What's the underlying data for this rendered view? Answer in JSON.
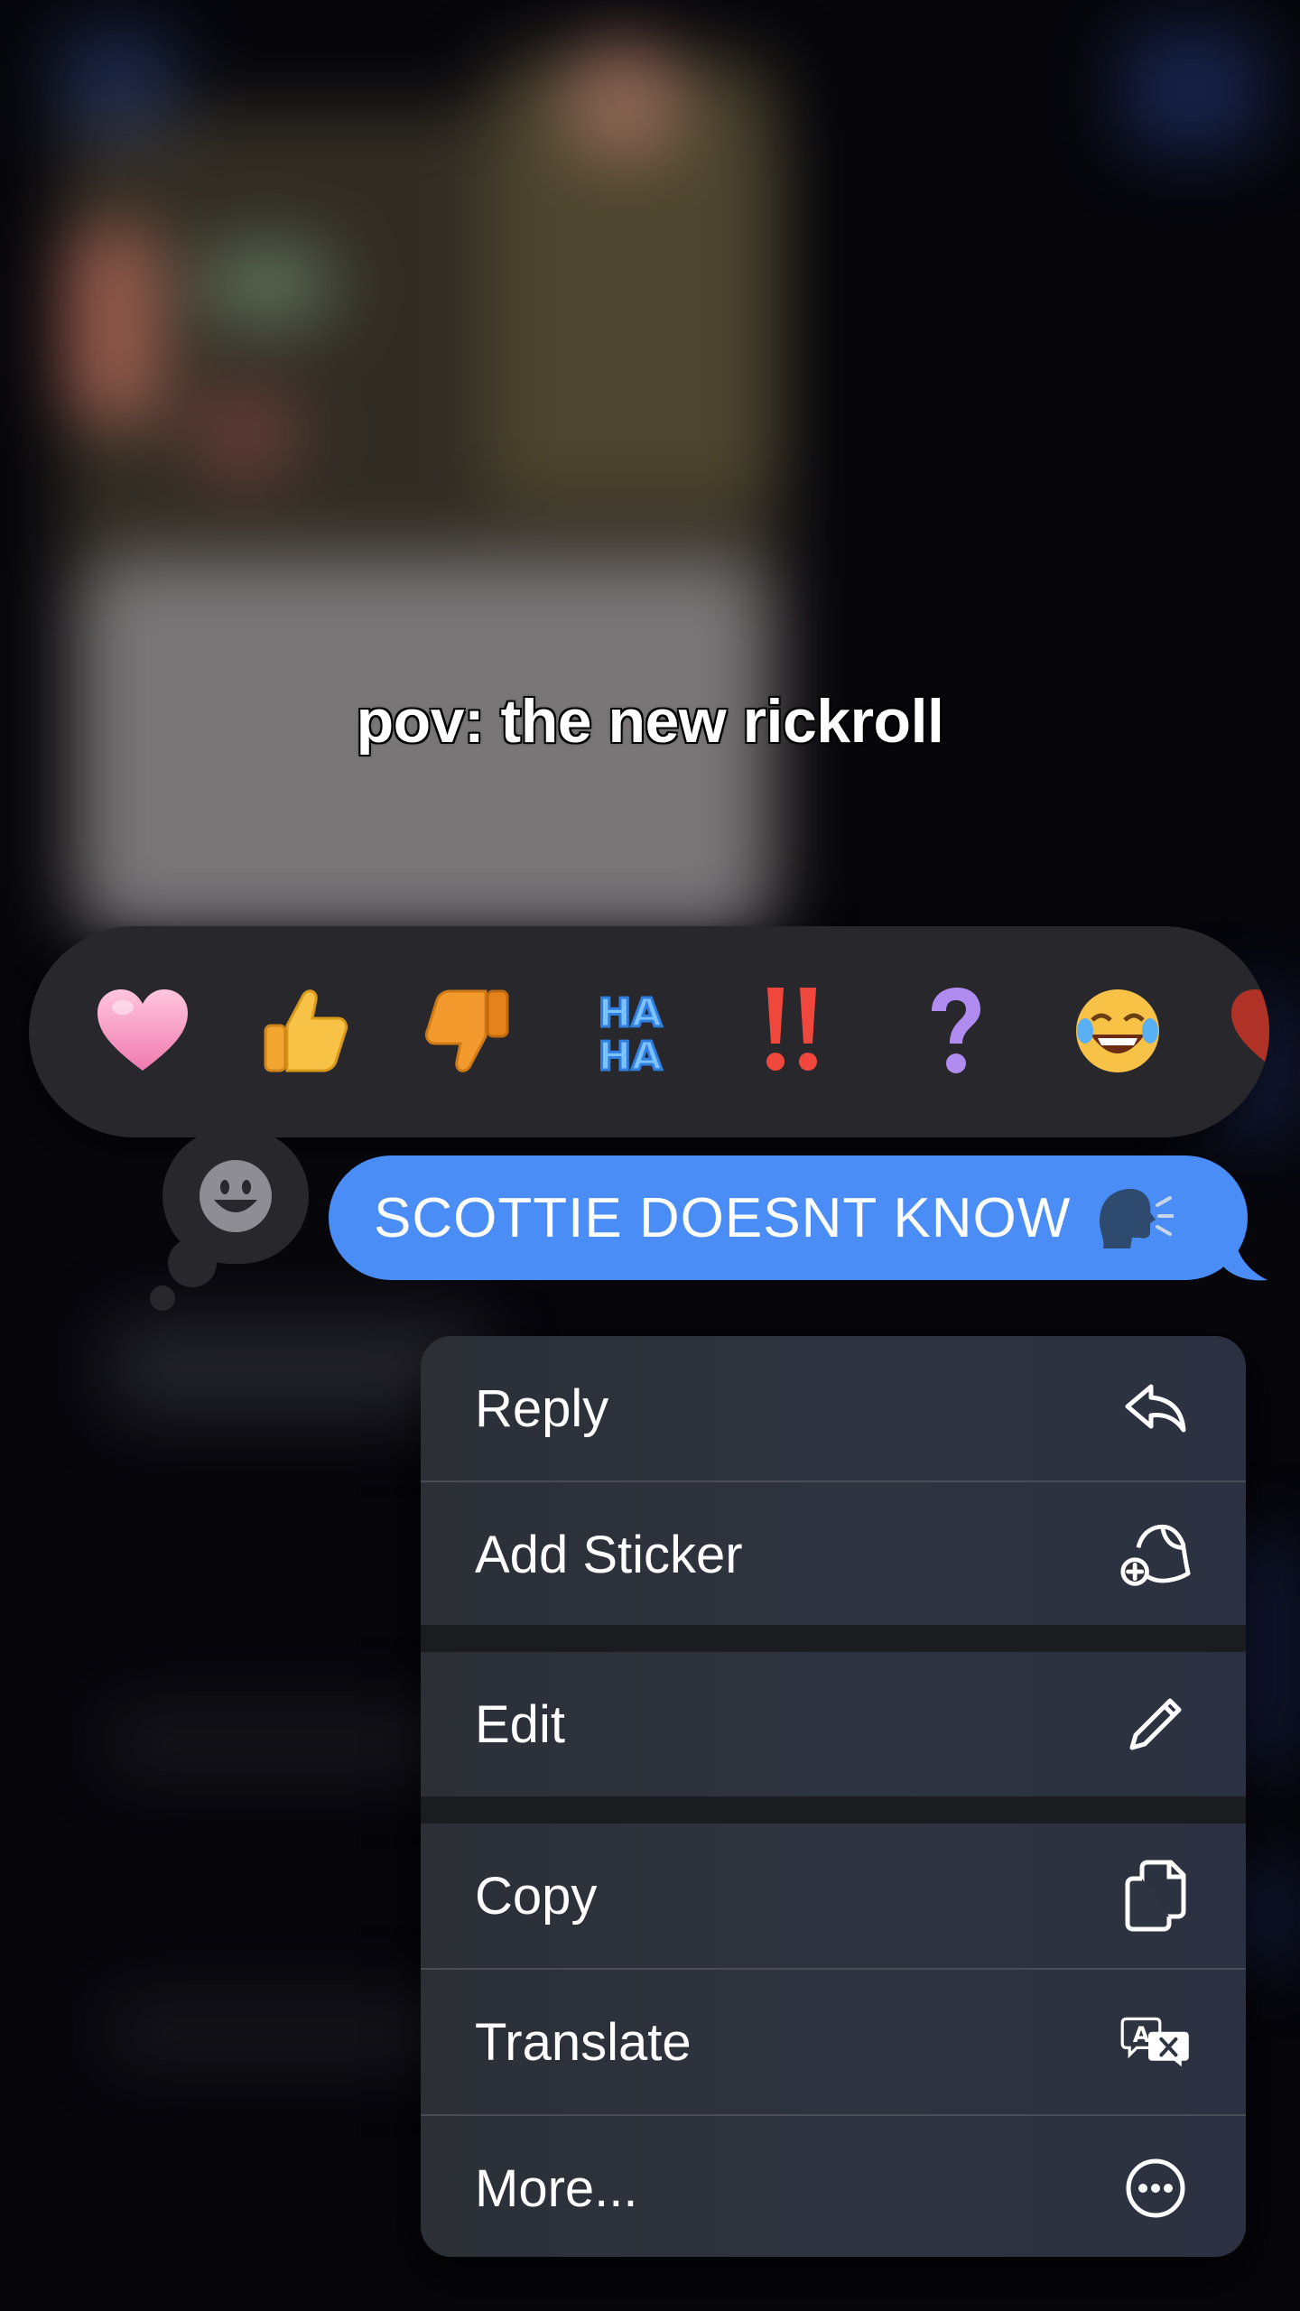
{
  "caption": "pov: the new rickroll",
  "reactions": [
    {
      "name": "heart",
      "color": "#f2a5c8"
    },
    {
      "name": "thumbs-up",
      "color": "#f7c245"
    },
    {
      "name": "thumbs-down",
      "color": "#f29a2e"
    },
    {
      "name": "haha",
      "line1": "HA",
      "line2": "HA",
      "color": "#5aaef7"
    },
    {
      "name": "exclamation",
      "color": "#f0473c"
    },
    {
      "name": "question",
      "color": "#b18cf0"
    },
    {
      "name": "laughing",
      "color": "#f7c245"
    },
    {
      "name": "heart-partial",
      "color": "#c0392b"
    }
  ],
  "message": {
    "text": "SCOTTIE DOESNT KNOW",
    "emoji": "speaking-head-icon",
    "bubble_color": "#4a8df7"
  },
  "menu": {
    "items": [
      {
        "label": "Reply",
        "icon": "reply-icon"
      },
      {
        "label": "Add Sticker",
        "icon": "add-sticker-icon"
      },
      {
        "label": "Edit",
        "icon": "pencil-icon"
      },
      {
        "label": "Copy",
        "icon": "copy-icon"
      },
      {
        "label": "Translate",
        "icon": "translate-icon"
      },
      {
        "label": "More...",
        "icon": "ellipsis-circle-icon"
      }
    ]
  }
}
